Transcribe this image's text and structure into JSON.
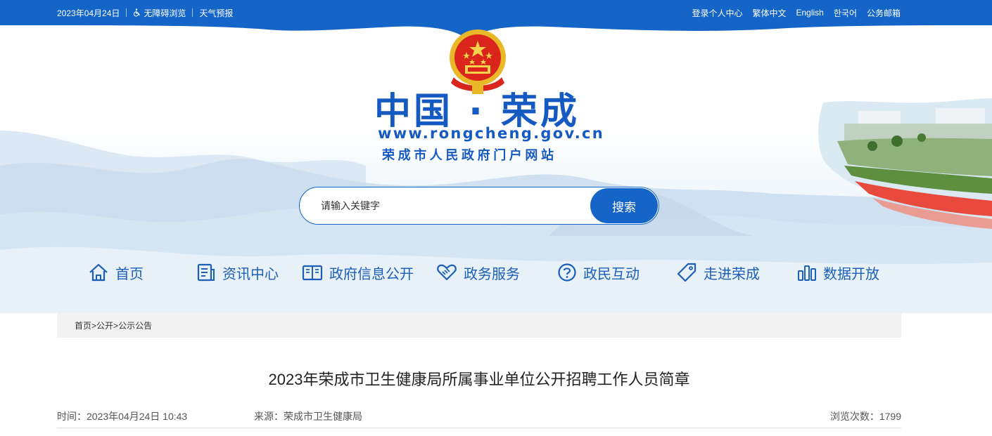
{
  "topbar": {
    "date": "2023年04月24日",
    "accessibility": "无障碍浏览",
    "weather": "天气预报",
    "links": [
      "登录个人中心",
      "繁体中文",
      "English",
      "한국어",
      "公务邮箱"
    ]
  },
  "header": {
    "site_title": "中国 · 荣成",
    "site_url": "www.rongcheng.gov.cn",
    "site_subtitle": "荣成市人民政府门户网站"
  },
  "search": {
    "placeholder": "请输入关键字",
    "button_label": "搜索"
  },
  "nav": [
    {
      "label": "首页",
      "icon": "home-icon"
    },
    {
      "label": "资讯中心",
      "icon": "news-icon"
    },
    {
      "label": "政府信息公开",
      "icon": "book-icon"
    },
    {
      "label": "政务服务",
      "icon": "handshake-icon"
    },
    {
      "label": "政民互动",
      "icon": "question-icon"
    },
    {
      "label": "走进荣成",
      "icon": "tag-icon"
    },
    {
      "label": "数据开放",
      "icon": "bar-chart-icon"
    }
  ],
  "breadcrumb": {
    "items": [
      "首页",
      "公开",
      "公示公告"
    ],
    "separator": ">"
  },
  "article": {
    "title": "2023年荣成市卫生健康局所属事业单位公开招聘工作人员简章",
    "time": "时间：2023年04月24日 10:43",
    "source": "来源：荣成市卫生健康局",
    "views": "浏览次数：1799"
  },
  "colors": {
    "primary": "#1565c8",
    "nav_text": "#1c5fb8",
    "title_blue": "#1559c2"
  }
}
